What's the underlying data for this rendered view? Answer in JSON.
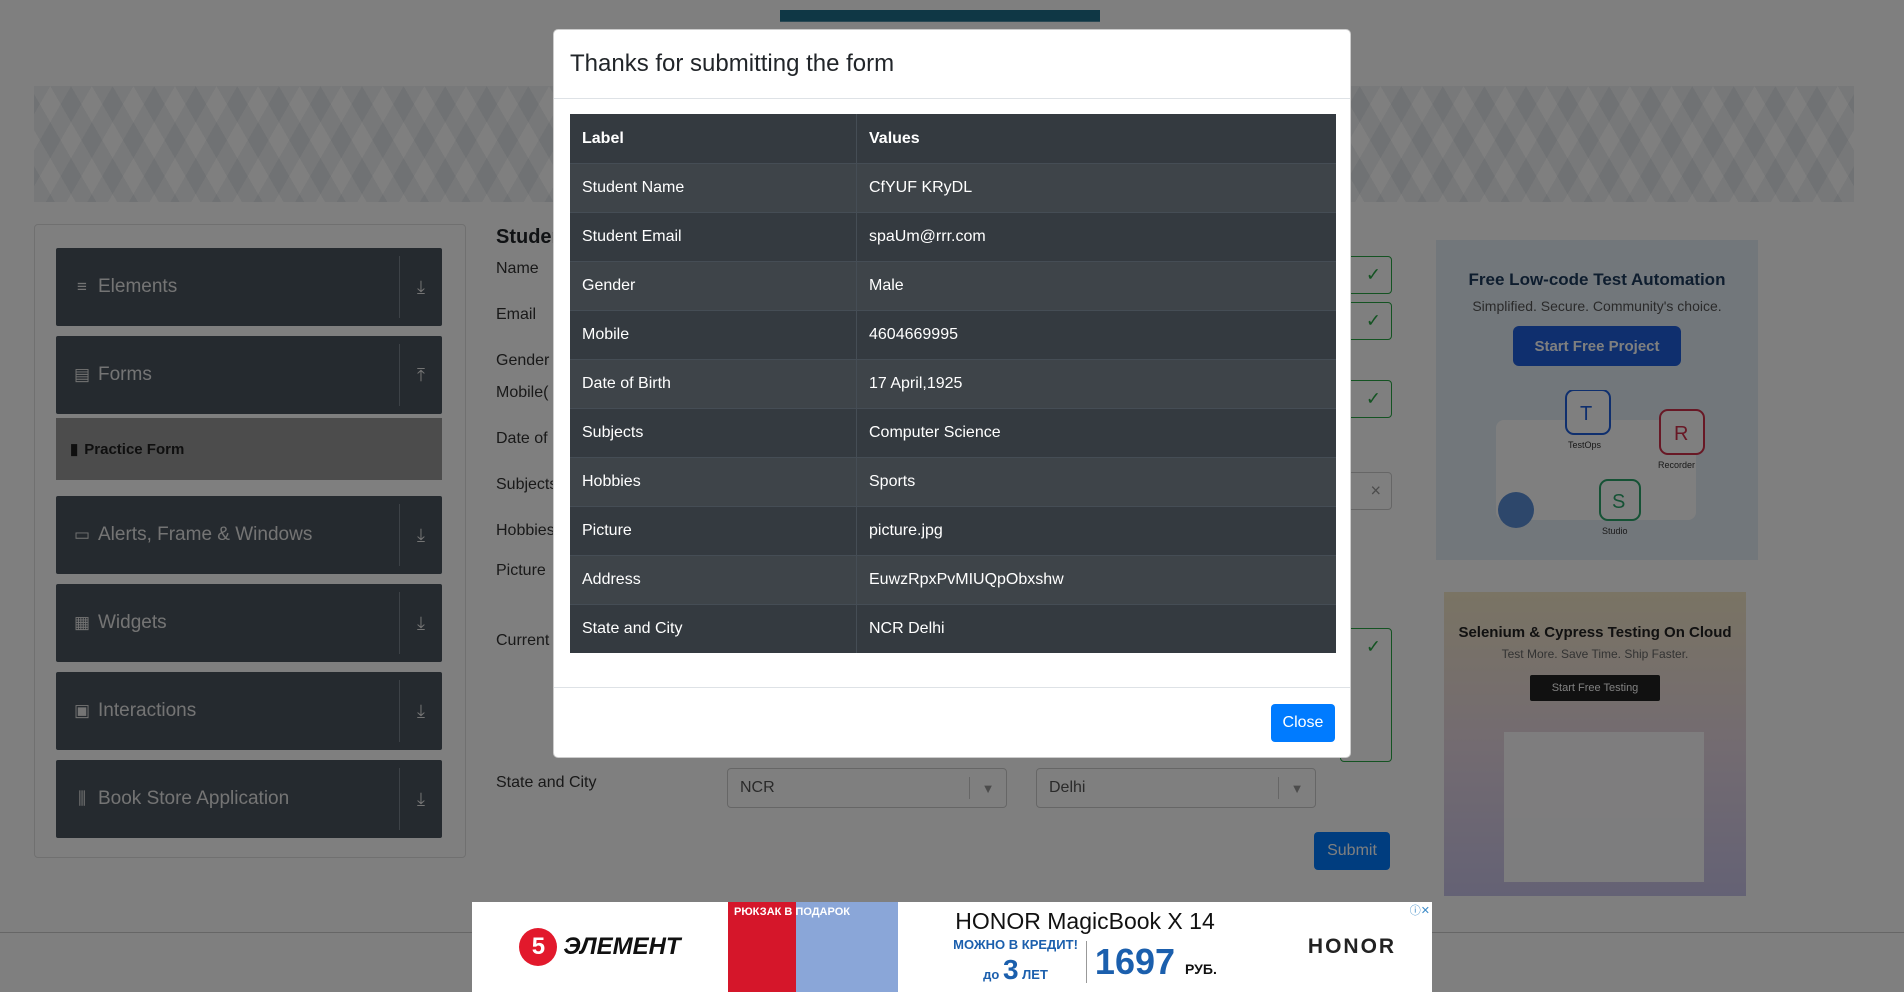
{
  "sidebar": {
    "groups": [
      {
        "label": "Elements"
      },
      {
        "label": "Forms"
      },
      {
        "label": "Alerts, Frame & Windows"
      },
      {
        "label": "Widgets"
      },
      {
        "label": "Interactions"
      },
      {
        "label": "Book Store Application"
      }
    ],
    "active_item": "Practice Form"
  },
  "form": {
    "heading": "Studen",
    "labels": {
      "name": "Name",
      "email": "Email",
      "gender": "Gender",
      "mobile": "Mobile(",
      "dob": "Date of",
      "subjects": "Subjects",
      "hobbies": "Hobbies",
      "picture": "Picture",
      "address": "Current",
      "state_city": "State and City"
    },
    "state_value": "NCR",
    "city_value": "Delhi",
    "submit_label": "Submit"
  },
  "right_ads": {
    "ad1": {
      "title": "Free Low-code Test Automation",
      "subtitle": "Simplified. Secure. Community's choice.",
      "button": "Start Free Project",
      "tags": [
        "TestOps",
        "Recorder",
        "Studio"
      ]
    },
    "ad2": {
      "title": "Selenium & Cypress Testing On Cloud",
      "subtitle": "Test More. Save Time. Ship Faster.",
      "button": "Start Free Testing"
    }
  },
  "bottom_ad": {
    "brand": "ЭЛЕМЕНТ",
    "brand_digit": "5",
    "promo": "РЮКЗАК В ПОДАРОК",
    "product": "HONOR MagicBook X 14",
    "credit_line1": "МОЖНО В КРЕДИТ!",
    "credit_prefix": "до",
    "credit_years": "3",
    "credit_suffix": "ЛЕТ",
    "price": "1697",
    "currency": "РУБ.",
    "maker": "HONOR"
  },
  "modal": {
    "title": "Thanks for submitting the form",
    "headers": [
      "Label",
      "Values"
    ],
    "rows": [
      [
        "Student Name",
        "CfYUF KRyDL"
      ],
      [
        "Student Email",
        "spaUm@rrr.com"
      ],
      [
        "Gender",
        "Male"
      ],
      [
        "Mobile",
        "4604669995"
      ],
      [
        "Date of Birth",
        "17 April,1925"
      ],
      [
        "Subjects",
        "Computer Science"
      ],
      [
        "Hobbies",
        "Sports"
      ],
      [
        "Picture",
        "picture.jpg"
      ],
      [
        "Address",
        "EuwzRpxPvMIUQpObxshw"
      ],
      [
        "State and City",
        "NCR Delhi"
      ]
    ],
    "close_label": "Close"
  },
  "colors": {
    "primary": "#007bff",
    "table_dark": "#343a40",
    "success": "#28a745",
    "sidebar_group": "#4a545e"
  }
}
